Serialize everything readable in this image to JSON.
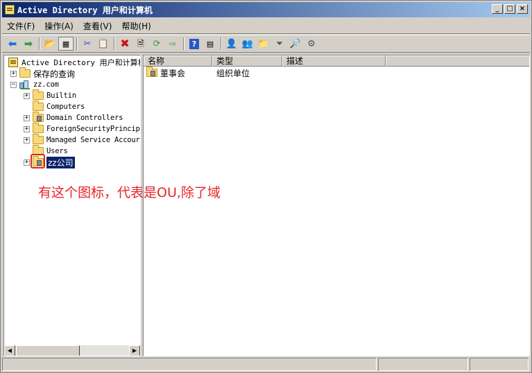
{
  "window": {
    "title": "Active Directory 用户和计算机"
  },
  "menubar": {
    "items": [
      "文件(F)",
      "操作(A)",
      "查看(V)",
      "帮助(H)"
    ]
  },
  "toolbar": {
    "icons": [
      "back-icon",
      "forward-icon",
      "up-folder-icon",
      "show-console-tree-icon",
      "cut-icon",
      "copy-icon",
      "delete-icon",
      "properties-icon",
      "refresh-icon",
      "export-icon",
      "help-icon",
      "show-tree-icon",
      "new-user-icon",
      "new-group-icon",
      "new-ou-icon",
      "filter-icon",
      "find-icon",
      "add-to-group-icon"
    ]
  },
  "tree": {
    "root": "Active Directory 用户和计算机",
    "saved_queries": "保存的查询",
    "domain": "zz.com",
    "children": [
      {
        "label": "Builtin",
        "expandable": true,
        "type": "container"
      },
      {
        "label": "Computers",
        "expandable": false,
        "type": "container"
      },
      {
        "label": "Domain Controllers",
        "expandable": true,
        "type": "ou"
      },
      {
        "label": "ForeignSecurityPrincip",
        "expandable": true,
        "type": "container"
      },
      {
        "label": "Managed Service Accour",
        "expandable": true,
        "type": "container"
      },
      {
        "label": "Users",
        "expandable": false,
        "type": "container"
      },
      {
        "label": "zz公司",
        "expandable": true,
        "type": "ou",
        "selected": true
      }
    ]
  },
  "list": {
    "columns": [
      "名称",
      "类型",
      "描述"
    ],
    "rows": [
      {
        "name": "董事会",
        "type": "组织单位",
        "description": ""
      }
    ]
  },
  "annotation": {
    "text": "有这个图标，代表是OU,除了域"
  },
  "colors": {
    "annotation": "#e8242a",
    "selection": "#0a246a",
    "title_gradient_start": "#0a246a"
  }
}
